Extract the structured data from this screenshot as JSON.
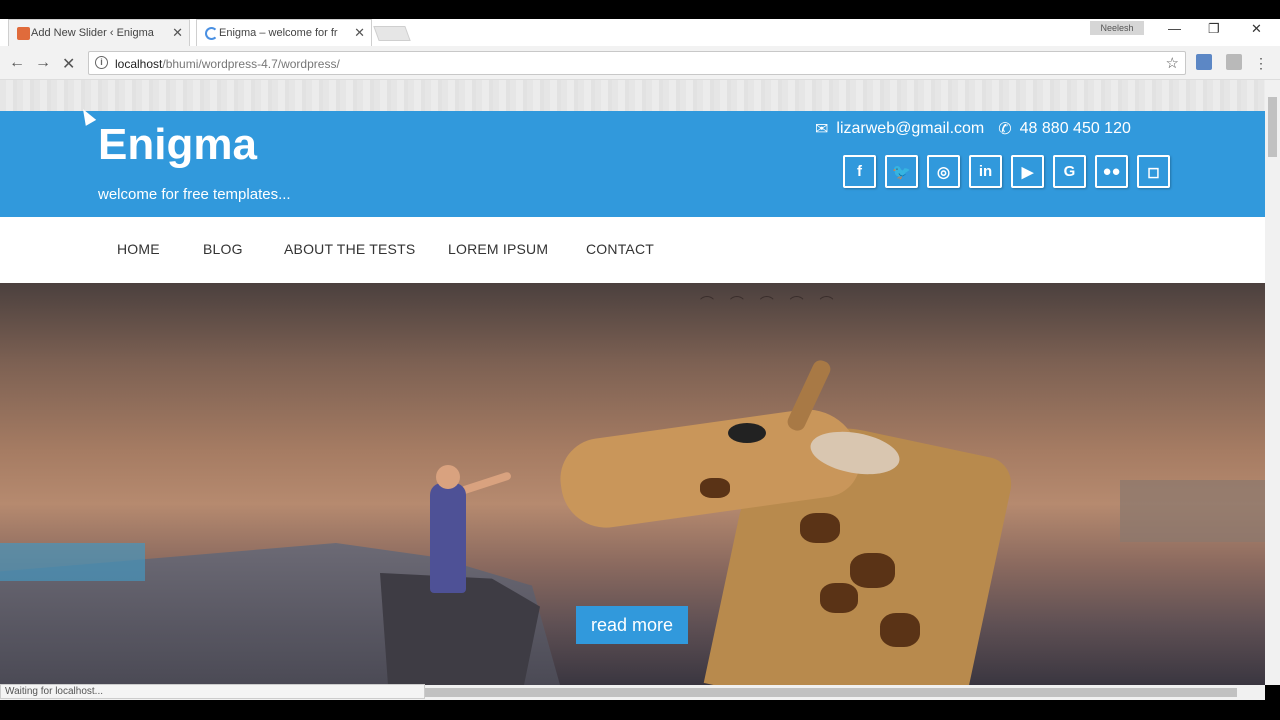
{
  "browser": {
    "tabs": [
      {
        "title": "Add New Slider ‹ Enigma",
        "favicon_color": "#e06b3b"
      },
      {
        "title": "Enigma – welcome for fr",
        "favicon_color": "#4a90e2"
      }
    ],
    "profile_name": "Neelesh",
    "url": {
      "host": "localhost",
      "path": "/bhumi/wordpress-4.7/wordpress/"
    },
    "status_text": "Waiting for localhost..."
  },
  "site": {
    "title": "Enigma",
    "tagline": "welcome for free templates...",
    "email": "lizarweb@gmail.com",
    "phone": "48 880 450 120",
    "brand_color": "#3199dc",
    "social": [
      {
        "name": "facebook",
        "glyph": "f"
      },
      {
        "name": "twitter",
        "glyph": "🐦"
      },
      {
        "name": "dribbble",
        "glyph": "◎"
      },
      {
        "name": "linkedin",
        "glyph": "in"
      },
      {
        "name": "youtube",
        "glyph": "▶"
      },
      {
        "name": "google",
        "glyph": "G"
      },
      {
        "name": "flickr",
        "glyph": "●●"
      },
      {
        "name": "instagram",
        "glyph": "◻"
      }
    ]
  },
  "nav": {
    "items": [
      "HOME",
      "BLOG",
      "ABOUT THE TESTS",
      "LOREM IPSUM",
      "CONTACT"
    ]
  },
  "hero": {
    "button_label": "read more"
  }
}
